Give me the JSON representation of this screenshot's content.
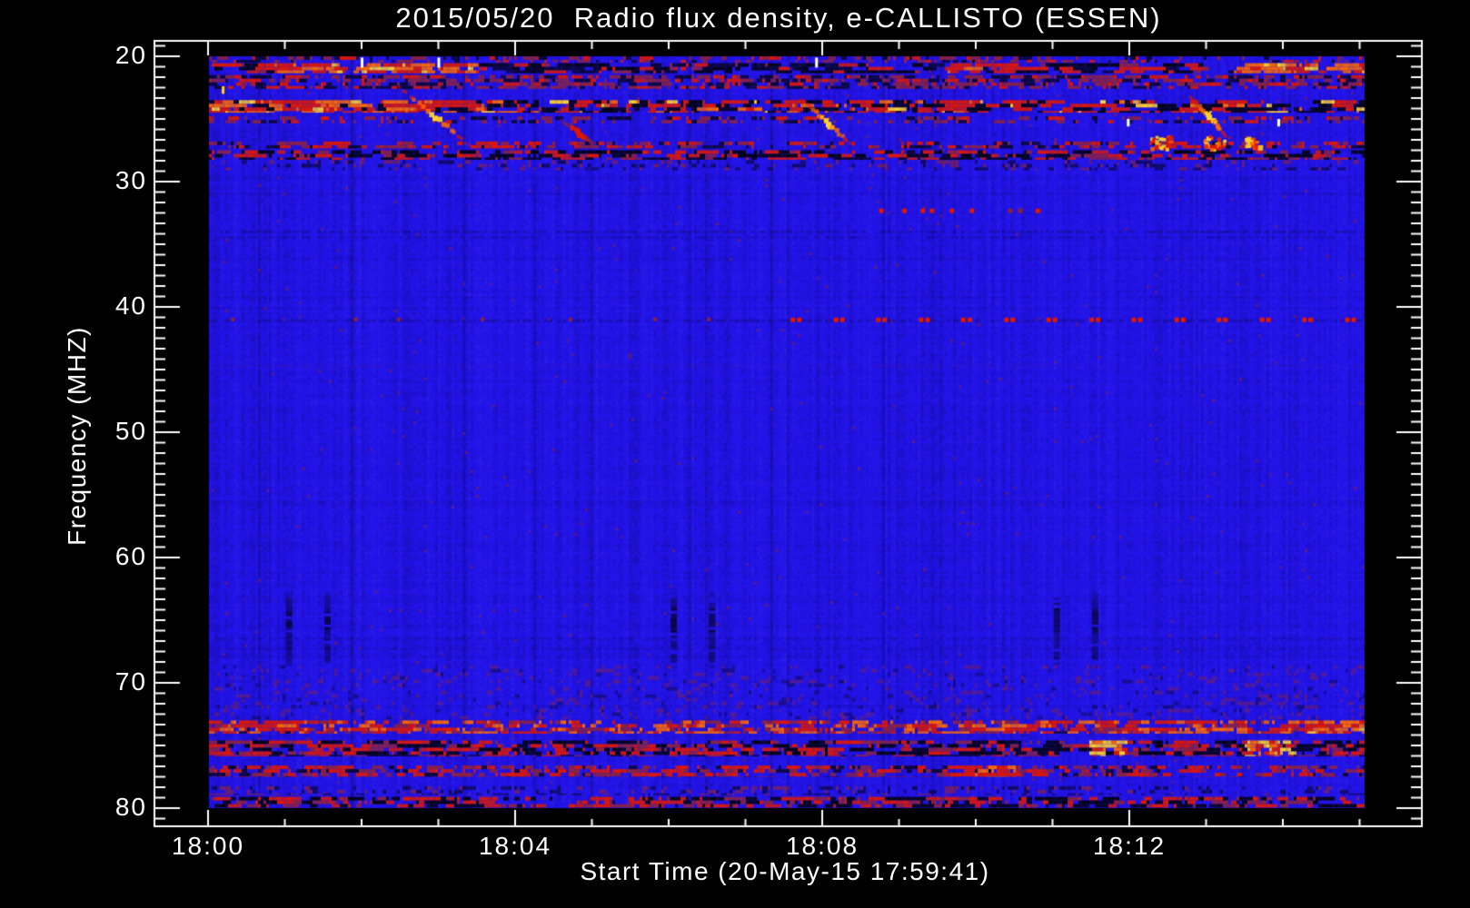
{
  "chart_data": {
    "type": "heatmap",
    "title": "2015/05/20  Radio flux density, e-CALLISTO (ESSEN)",
    "x_axis": {
      "label": "Start Time (20-May-15 17:59:41)",
      "major_ticks": [
        {
          "label": "18:00",
          "minute": 0
        },
        {
          "label": "18:04",
          "minute": 4
        },
        {
          "label": "18:08",
          "minute": 8
        },
        {
          "label": "18:12",
          "minute": 12
        }
      ],
      "minor_step_min": 1,
      "minute_min": 0,
      "minute_max": 15
    },
    "y_axis": {
      "label": "Frequency (MHZ)",
      "major_ticks": [
        20,
        30,
        40,
        50,
        60,
        70,
        80
      ],
      "minor_per_major": 12
    },
    "freq_range": [
      20,
      80
    ],
    "time_range_min": [
      0,
      15.07
    ],
    "legend": "none",
    "grid": false,
    "colors": {
      "blue": "#2213e6",
      "black": "#02020c",
      "dark": "#0a0630",
      "dimred": "#8c2240",
      "red": "#e01800",
      "orange": "#ff6a00",
      "yellow": "#ffd22a",
      "white": "#ffffff",
      "purple": "#4a14c8",
      "frame": "#ffffff"
    },
    "styles": {
      "mild_speck": {
        "persist": 0.4,
        "w": [
          [
            "bg",
            0.62
          ],
          [
            "dimred",
            0.2
          ],
          [
            "dark",
            0.1
          ],
          [
            "red",
            0.08
          ]
        ]
      },
      "dark_mix": {
        "persist": 0.72,
        "w": [
          [
            "black",
            0.34
          ],
          [
            "dark",
            0.14
          ],
          [
            "bg",
            0.3
          ],
          [
            "red",
            0.14
          ],
          [
            "dimred",
            0.08
          ]
        ]
      },
      "speck_dense": {
        "persist": 0.45,
        "w": [
          [
            "dimred",
            0.3
          ],
          [
            "red",
            0.16
          ],
          [
            "dark",
            0.2
          ],
          [
            "bg",
            0.34
          ]
        ]
      },
      "strong_band": {
        "persist": 0.65,
        "w": [
          [
            "black",
            0.3
          ],
          [
            "red",
            0.32
          ],
          [
            "orange",
            0.08
          ],
          [
            "bg",
            0.26
          ],
          [
            "yellow",
            0.04
          ]
        ]
      },
      "red_speck": {
        "persist": 0.5,
        "w": [
          [
            "red",
            0.26
          ],
          [
            "dimred",
            0.22
          ],
          [
            "dark",
            0.12
          ],
          [
            "bg",
            0.4
          ]
        ]
      },
      "dark_red2": {
        "persist": 0.6,
        "w": [
          [
            "black",
            0.3
          ],
          [
            "red",
            0.28
          ],
          [
            "dimred",
            0.14
          ],
          [
            "bg",
            0.28
          ]
        ]
      },
      "faint_speck": {
        "persist": 0.4,
        "alpha": 0.75,
        "w": [
          [
            "dark",
            0.16
          ],
          [
            "dimred",
            0.12
          ],
          [
            "bg",
            0.72
          ]
        ]
      },
      "orange_band": {
        "persist": 0.55,
        "w": [
          [
            "orange",
            0.26
          ],
          [
            "red",
            0.3
          ],
          [
            "dimred",
            0.14
          ],
          [
            "bg",
            0.3
          ]
        ]
      },
      "mist": {
        "persist": 0.3,
        "alpha": 0.5,
        "w": [
          [
            "dimred",
            0.1
          ],
          [
            "dark",
            0.05
          ],
          [
            "bg",
            0.85
          ]
        ]
      },
      "orange_run": {
        "persist": 0.6,
        "w": [
          [
            "orange",
            0.5
          ],
          [
            "red",
            0.3
          ],
          [
            "yellow",
            0.08
          ],
          [
            "bg",
            0.12
          ]
        ]
      },
      "red_run": {
        "persist": 0.6,
        "w": [
          [
            "red",
            0.55
          ],
          [
            "orange",
            0.18
          ],
          [
            "dark",
            0.1
          ],
          [
            "bg",
            0.17
          ]
        ]
      },
      "solid_red": {
        "persist": 0.7,
        "w": [
          [
            "red",
            0.48
          ],
          [
            "orange",
            0.3
          ],
          [
            "black",
            0.08
          ],
          [
            "yellow",
            0.04
          ],
          [
            "bg",
            0.1
          ]
        ]
      },
      "spark": {
        "persist": 0.5,
        "w": [
          [
            "yellow",
            0.25
          ],
          [
            "orange",
            0.3
          ],
          [
            "red",
            0.28
          ],
          [
            "black",
            0.07
          ],
          [
            "bg",
            0.1
          ]
        ]
      }
    },
    "bands": [
      {
        "f": [
          20.0,
          20.5
        ],
        "style": "mild_speck"
      },
      {
        "f": [
          20.55,
          21.35
        ],
        "style": "dark_mix",
        "segments": [
          {
            "t": [
              0.8,
              3.45
            ],
            "style": "orange_run"
          },
          {
            "t": [
              9.55,
              10.45
            ],
            "style": "red_run"
          },
          {
            "t": [
              13.3,
              15.1
            ],
            "style": "orange_run"
          }
        ]
      },
      {
        "f": [
          21.5,
          22.6
        ],
        "style": "speck_dense"
      },
      {
        "f": [
          23.5,
          24.5
        ],
        "style": "strong_band",
        "segments": [
          {
            "t": [
              0,
              3.4
            ],
            "style": "solid_red"
          },
          {
            "t": [
              7.35,
              7.7
            ],
            "style": "red_run"
          }
        ]
      },
      {
        "f": [
          24.8,
          25.35
        ],
        "style": "mild_speck"
      },
      {
        "f": [
          26.8,
          27.35
        ],
        "style": "red_speck"
      },
      {
        "f": [
          27.5,
          28.25
        ],
        "style": "dark_red2"
      },
      {
        "f": [
          28.3,
          29.1
        ],
        "style": "faint_speck"
      },
      {
        "f": [
          68.6,
          72.9
        ],
        "style": "mist"
      },
      {
        "f": [
          73.0,
          74.05
        ],
        "style": "orange_band",
        "segments": [
          {
            "t": [
              0.4,
              1.15
            ],
            "style": "red_run"
          },
          {
            "t": [
              10.5,
              11.05
            ],
            "style": "red_run"
          },
          {
            "t": [
              14.3,
              15.1
            ],
            "style": "orange_run"
          }
        ]
      },
      {
        "f": [
          74.6,
          75.85
        ],
        "style": "dark_red2",
        "segments": [
          {
            "t": [
              11.45,
              11.9
            ],
            "style": "spark"
          },
          {
            "t": [
              13.5,
              14.1
            ],
            "style": "spark"
          }
        ]
      },
      {
        "f": [
          76.6,
          77.5
        ],
        "style": "red_speck",
        "segments": [
          {
            "t": [
              9.7,
              10.5
            ],
            "style": "red_run"
          }
        ]
      },
      {
        "f": [
          78.25,
          78.95
        ],
        "style": "faint_speck"
      },
      {
        "f": [
          79.1,
          79.95
        ],
        "style": "dark_red2"
      }
    ],
    "faint_lines": [
      {
        "f": 33.9,
        "alpha": 0.3,
        "color": "dark"
      },
      {
        "f": 34.35,
        "alpha": 0.22,
        "color": "dark"
      },
      {
        "f": 41.0,
        "alpha": 0.3,
        "color": "dark"
      },
      {
        "f": 44.6,
        "alpha": 0.12,
        "color": "dimred"
      },
      {
        "f": 63.3,
        "alpha": 0.1,
        "color": "dark"
      },
      {
        "f": 66.4,
        "alpha": 0.2,
        "color": "dark"
      },
      {
        "f": 67.2,
        "alpha": 0.16,
        "color": "dark"
      },
      {
        "f": 71.8,
        "alpha": 0.14,
        "color": "dark"
      }
    ],
    "dot_rows": [
      {
        "f": 32.3,
        "color": "red",
        "size": 5,
        "times": [
          8.74,
          9.04,
          9.28,
          9.4,
          9.66,
          9.92,
          10.78
        ]
      },
      {
        "f": 32.3,
        "color": "dimred",
        "size": 5,
        "times": [
          10.42,
          10.55
        ]
      },
      {
        "f": 41.0,
        "color": "red",
        "size": 5,
        "pair": true,
        "times": [
          7.59,
          8.15,
          8.7,
          9.26,
          9.81,
          10.37,
          10.92,
          11.48,
          12.03,
          12.59,
          13.14,
          13.7,
          14.25,
          14.81
        ]
      },
      {
        "f": 41.0,
        "color": "dimred",
        "size": 4,
        "times": [
          0.3,
          1.9,
          2.46,
          3.55,
          4.7,
          5.8,
          6.5
        ]
      }
    ],
    "strip_freq_range": [
      62.3,
      69.0
    ],
    "strip_times": [
      1.05,
      1.55,
      6.06,
      6.56,
      11.05,
      11.55
    ],
    "sweeps": [
      {
        "t": [
          2.46,
          3.4
        ],
        "f": [
          22.3,
          27.0
        ],
        "bright": 0.85
      },
      {
        "t": [
          4.6,
          5.0
        ],
        "f": [
          25.0,
          26.9
        ],
        "bright": 0.25
      },
      {
        "t": [
          7.7,
          8.38
        ],
        "f": [
          23.3,
          27.0
        ],
        "bright": 1
      },
      {
        "t": [
          12.77,
          13.28
        ],
        "f": [
          23.1,
          26.4
        ],
        "bright": 1
      }
    ],
    "blobs": [
      {
        "t": [
          12.26,
          12.52
        ],
        "f": [
          26.2,
          27.4
        ]
      },
      {
        "t": [
          12.95,
          13.24
        ],
        "f": [
          26.2,
          27.4
        ]
      },
      {
        "t": [
          13.5,
          13.74
        ],
        "f": [
          26.3,
          27.2
        ]
      }
    ],
    "artifacts": [
      {
        "t": 2.0,
        "f": [
          20.1,
          20.9
        ],
        "color": "white"
      },
      {
        "t": 3.0,
        "f": [
          20.1,
          20.9
        ],
        "color": "white"
      },
      {
        "t": 7.92,
        "f": [
          20.1,
          20.9
        ],
        "color": "white"
      },
      {
        "t": 0.19,
        "f": [
          22.4,
          23.0
        ],
        "color": "yellow"
      },
      {
        "t": 11.98,
        "f": [
          25.0,
          25.6
        ],
        "color": "white"
      },
      {
        "t": 13.94,
        "f": [
          25.0,
          25.6
        ],
        "color": "white"
      }
    ]
  }
}
